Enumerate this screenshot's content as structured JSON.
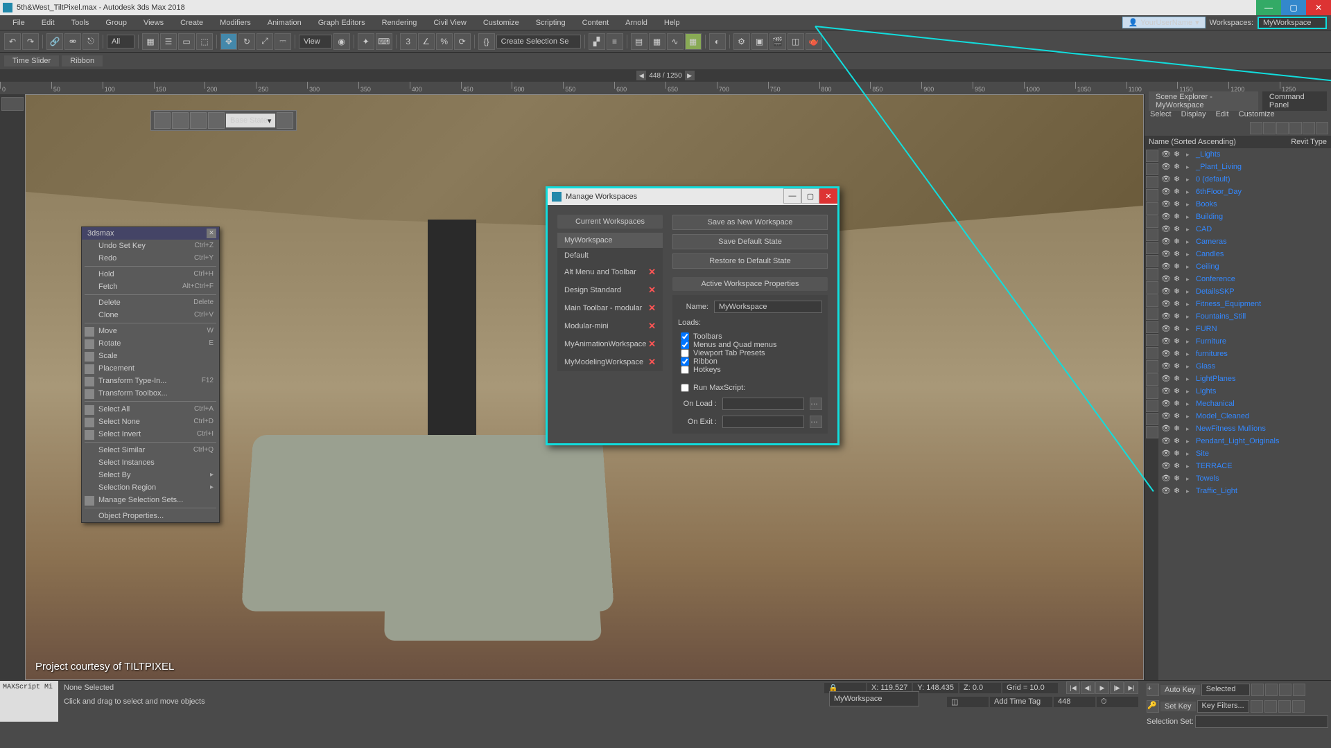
{
  "title": "5th&West_TiltPixel.max - Autodesk 3ds Max 2018",
  "user": {
    "name": "YourUserName",
    "workspaces_label": "Workspaces:",
    "current": "MyWorkspace"
  },
  "menu": [
    "File",
    "Edit",
    "Tools",
    "Group",
    "Views",
    "Create",
    "Modifiers",
    "Animation",
    "Graph Editors",
    "Rendering",
    "Civil View",
    "Customize",
    "Scripting",
    "Content",
    "Arnold",
    "Help"
  ],
  "toolbar": {
    "all": "All",
    "view": "View",
    "selset": "Create Selection Se"
  },
  "ribbon": {
    "tabs": [
      "Time Slider",
      "Ribbon"
    ]
  },
  "frame": {
    "current": "448 / 1250"
  },
  "timeline": {
    "ticks": [
      "0",
      "50",
      "100",
      "150",
      "200",
      "250",
      "300",
      "350",
      "400",
      "450",
      "500",
      "550",
      "600",
      "650",
      "700",
      "750",
      "800",
      "850",
      "900",
      "950",
      "1000",
      "1050",
      "1100",
      "1150",
      "1200",
      "1250"
    ]
  },
  "viewport": {
    "state_combo": "Base State",
    "credit": "Project courtesy of TILTPIXEL"
  },
  "context_menu": {
    "title": "3dsmax",
    "items": [
      {
        "label": "Undo Set Key",
        "sc": "Ctrl+Z",
        "dis": true
      },
      {
        "label": "Redo",
        "sc": "Ctrl+Y",
        "dis": true
      },
      {
        "sep": true
      },
      {
        "label": "Hold",
        "sc": "Ctrl+H"
      },
      {
        "label": "Fetch",
        "sc": "Alt+Ctrl+F",
        "dis": true
      },
      {
        "sep": true
      },
      {
        "label": "Delete",
        "sc": "Delete"
      },
      {
        "label": "Clone",
        "sc": "Ctrl+V",
        "dis": true
      },
      {
        "sep": true
      },
      {
        "label": "Move",
        "sc": "W",
        "ico": true
      },
      {
        "label": "Rotate",
        "sc": "E",
        "ico": true
      },
      {
        "label": "Scale",
        "sc": "",
        "ico": true
      },
      {
        "label": "Placement",
        "sc": "",
        "ico": true
      },
      {
        "label": "Transform Type-In...",
        "sc": "F12",
        "ico": true
      },
      {
        "label": "Transform Toolbox...",
        "sc": "",
        "ico": true
      },
      {
        "sep": true
      },
      {
        "label": "Select All",
        "sc": "Ctrl+A",
        "ico": true
      },
      {
        "label": "Select None",
        "sc": "Ctrl+D",
        "ico": true
      },
      {
        "label": "Select Invert",
        "sc": "Ctrl+I",
        "ico": true
      },
      {
        "sep": true
      },
      {
        "label": "Select Similar",
        "sc": "Ctrl+Q",
        "dis": true
      },
      {
        "label": "Select Instances",
        "dis": true
      },
      {
        "label": "Select By",
        "sub": true
      },
      {
        "label": "Selection Region",
        "sub": true
      },
      {
        "label": "Manage Selection Sets...",
        "ico": true
      },
      {
        "sep": true
      },
      {
        "label": "Object Properties...",
        "dis": true
      }
    ]
  },
  "dialog": {
    "title": "Manage Workspaces",
    "current_header": "Current Workspaces",
    "workspaces": [
      {
        "name": "MyWorkspace",
        "sel": true,
        "del": false
      },
      {
        "name": "Default",
        "del": false
      },
      {
        "name": "Alt Menu and Toolbar",
        "del": true
      },
      {
        "name": "Design Standard",
        "del": true
      },
      {
        "name": "Main Toolbar - modular",
        "del": true
      },
      {
        "name": "Modular-mini",
        "del": true
      },
      {
        "name": "MyAnimationWorkspace",
        "del": true
      },
      {
        "name": "MyModelingWorkspace",
        "del": true
      }
    ],
    "buttons": {
      "save_new": "Save as New Workspace",
      "save_default": "Save Default State",
      "restore": "Restore to Default State"
    },
    "props_header": "Active Workspace Properties",
    "name_label": "Name:",
    "name_value": "MyWorkspace",
    "loads_label": "Loads:",
    "loads": [
      {
        "label": "Toolbars",
        "checked": true
      },
      {
        "label": "Menus and Quad menus",
        "checked": true
      },
      {
        "label": "Viewport Tab Presets",
        "checked": false
      },
      {
        "label": "Ribbon",
        "checked": true
      },
      {
        "label": "Hotkeys",
        "checked": false
      }
    ],
    "run_script": "Run MaxScript:",
    "on_load": "On Load :",
    "on_exit": "On Exit :"
  },
  "scene_explorer": {
    "title": "Scene Explorer - MyWorkspace",
    "cmd_panel": "Command Panel",
    "menu": [
      "Select",
      "Display",
      "Edit",
      "Customize"
    ],
    "col_name": "Name (Sorted Ascending)",
    "col_revit": "Revit Type",
    "items": [
      "_Lights",
      "_Plant_Living",
      "0 (default)",
      "6thFloor_Day",
      "Books",
      "Building",
      "CAD",
      "Cameras",
      "Candles",
      "Ceiling",
      "Conference",
      "DetailsSKP",
      "Fitness_Equipment",
      "Fountains_Still",
      "FURN",
      "Furniture",
      "furnitures",
      "Glass",
      "LightPlanes",
      "Lights",
      "Mechanical",
      "Model_Cleaned",
      "NewFitness Mullions",
      "Pendant_Light_Originals",
      "Site",
      "TERRACE",
      "Towels",
      "Traffic_Light"
    ]
  },
  "status": {
    "script": "MAXScript Mi",
    "none_sel": "None Selected",
    "hint": "Click and drag to select and move objects",
    "x": "X: 119.527",
    "y": "Y: 148.435",
    "z": "Z: 0.0",
    "grid": "Grid = 10.0",
    "frame": "448",
    "add_tag": "Add Time Tag",
    "autokey": "Auto Key",
    "setkey": "Set Key",
    "selected": "Selected",
    "keyfilters": "Key Filters...",
    "selset_label": "Selection Set:"
  },
  "bottom_combo": "MyWorkspace"
}
